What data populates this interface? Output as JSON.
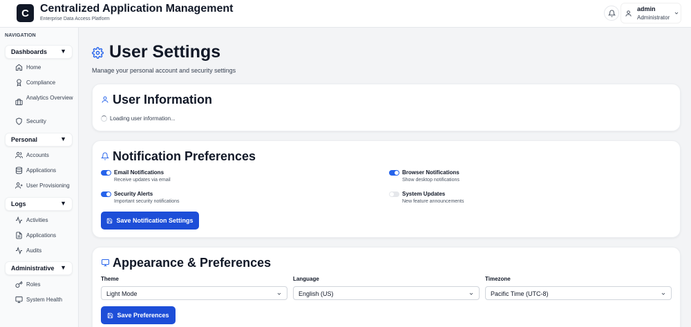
{
  "header": {
    "logo_letter": "C",
    "title": "Centralized Application Management",
    "subtitle": "Enterprise Data Access Platform",
    "user": {
      "name": "admin",
      "role": "Administrator"
    }
  },
  "sidebar": {
    "nav_label": "NAVIGATION",
    "sections": [
      {
        "title": "Dashboards",
        "arrow": "▼",
        "items": [
          {
            "label": "Home",
            "icon": "home-icon"
          },
          {
            "label": "Compliance",
            "icon": "award-icon"
          },
          {
            "label": "Analytics Overview",
            "icon": "briefcase-icon"
          },
          {
            "label": "Security",
            "icon": "shield-icon"
          }
        ]
      },
      {
        "title": "Personal",
        "arrow": "▼",
        "items": [
          {
            "label": "Accounts",
            "icon": "users-icon"
          },
          {
            "label": "Applications",
            "icon": "database-icon"
          },
          {
            "label": "User Provisioning",
            "icon": "user-plus-icon"
          }
        ]
      },
      {
        "title": "Logs",
        "arrow": "▼",
        "items": [
          {
            "label": "Activities",
            "icon": "activity-icon"
          },
          {
            "label": "Applications",
            "icon": "file-icon"
          },
          {
            "label": "Audits",
            "icon": "activity-icon"
          }
        ]
      },
      {
        "title": "Administrative",
        "arrow": "▼",
        "items": [
          {
            "label": "Roles",
            "icon": "key-icon"
          },
          {
            "label": "System Health",
            "icon": "monitor-icon"
          }
        ]
      }
    ]
  },
  "page": {
    "title": "User Settings",
    "description": "Manage your personal account and security settings"
  },
  "user_info": {
    "title": "User Information",
    "loading_text": "Loading user information..."
  },
  "notifications": {
    "title": "Notification Preferences",
    "items": [
      {
        "title": "Email Notifications",
        "desc": "Receive updates via email",
        "enabled": true
      },
      {
        "title": "Browser Notifications",
        "desc": "Show desktop notifications",
        "enabled": true
      },
      {
        "title": "Security Alerts",
        "desc": "Important security notifications",
        "enabled": true
      },
      {
        "title": "System Updates",
        "desc": "New feature announcements",
        "enabled": false
      }
    ],
    "save_label": "Save Notification Settings"
  },
  "appearance": {
    "title": "Appearance & Preferences",
    "theme": {
      "label": "Theme",
      "value": "Light Mode"
    },
    "language": {
      "label": "Language",
      "value": "English (US)"
    },
    "timezone": {
      "label": "Timezone",
      "value": "Pacific Time (UTC-8)"
    },
    "save_label": "Save Preferences"
  },
  "colors": {
    "accent": "#1d4ed8",
    "icon_blue": "#2563eb",
    "toggle_off": "#e5e7eb"
  }
}
